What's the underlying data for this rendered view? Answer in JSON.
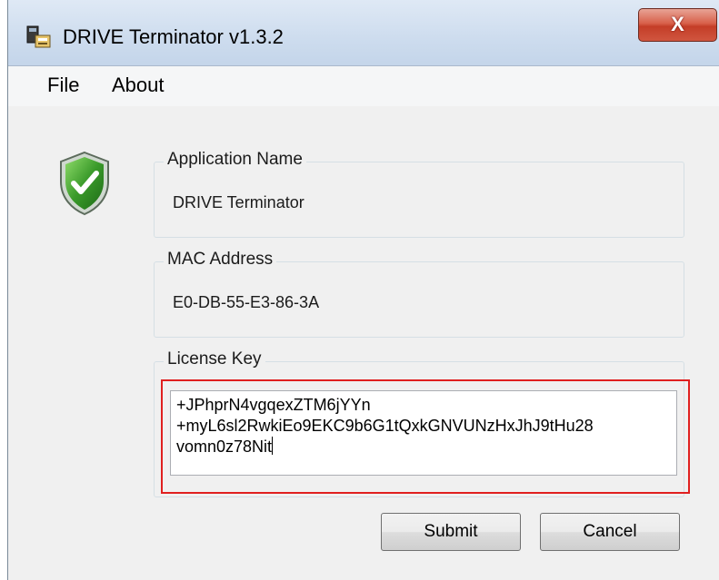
{
  "window": {
    "title": "DRIVE Terminator v1.3.2",
    "close_label": "X"
  },
  "menu": {
    "items": [
      "File",
      "About"
    ]
  },
  "form": {
    "application_name": {
      "label": "Application Name",
      "value": "DRIVE Terminator"
    },
    "mac_address": {
      "label": "MAC Address",
      "value": "E0-DB-55-E3-86-3A"
    },
    "license_key": {
      "label": "License Key",
      "value": "+JPhprN4vgqexZTM6jYYn\n+myL6sl2RwkiEo9EKC9b6G1tQxkGNVUNzHxJhJ9tHu28\nvomn0z78Nit"
    }
  },
  "buttons": {
    "submit": "Submit",
    "cancel": "Cancel"
  },
  "icons": {
    "app": "app-icon",
    "status": "green-shield-check-icon"
  },
  "colors": {
    "highlight": "#e02020",
    "shield": "#3a9a2a"
  }
}
